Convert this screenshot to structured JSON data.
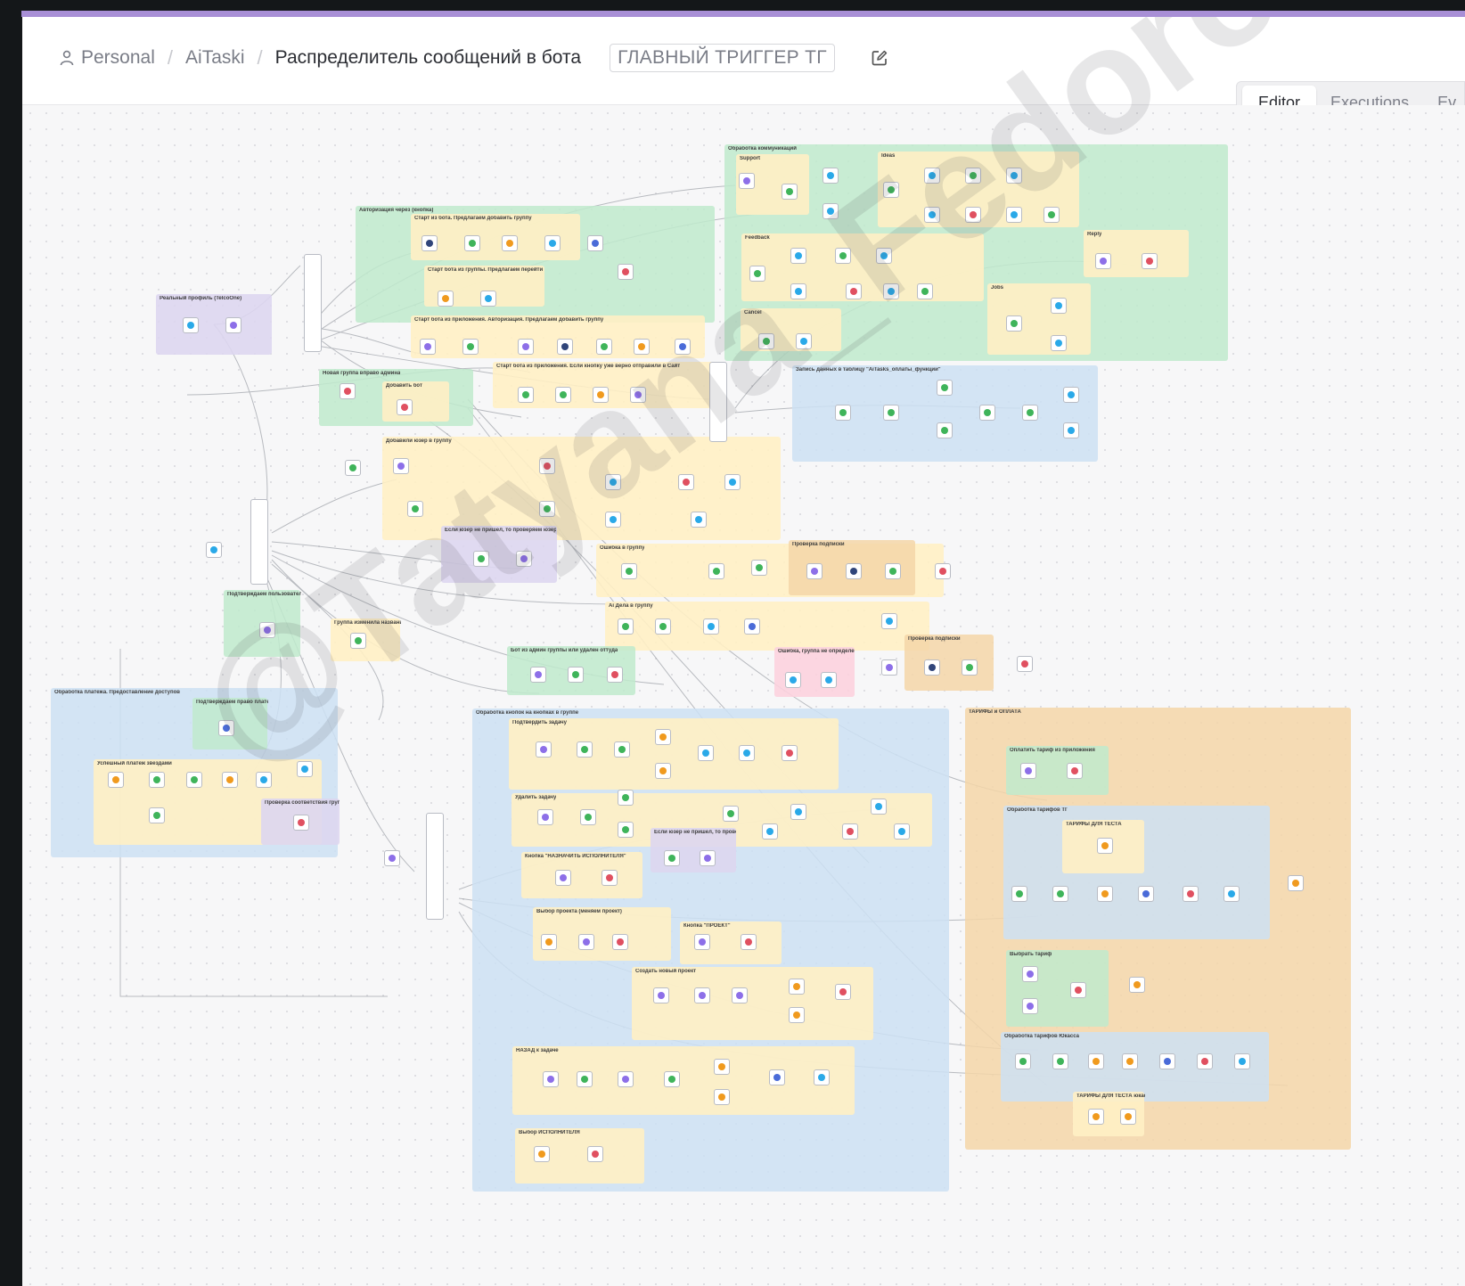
{
  "header": {
    "breadcrumb": {
      "owner": "Personal",
      "project": "AiTaski",
      "workflow": "Распределитель сообщений в бота"
    },
    "tag": "ГЛАВНЫЙ ТРИГГЕР ТГ",
    "tabs": [
      {
        "label": "Editor",
        "active": true
      },
      {
        "label": "Executions"
      },
      {
        "label": "Ev"
      }
    ]
  },
  "canvas": {
    "sticky_notes": [
      "Обработка коммуникаций",
      "Авторизация через (кнопка)",
      "Старт из бота. Предлагаем добавить группу",
      "Старт бота из группы. Предлагаем перейти в настройки приложения",
      "Старт бота из приложения. Авторизация. Предлагаем добавить группу",
      "Старт бота из приложения. Если кнопку уже верно отправили в Сайт",
      "Реальный профиль (TelcoOne)",
      "Новая группа вправо админа",
      "Добавить бот",
      "Добавили юзер в группу",
      "Если юзер не пришел, то проверяем юзер группы",
      "Ошибка в группу",
      "Проверка подписки",
      "Ai Дела в группу",
      "Бот из админ группы или удален оттуда",
      "Ошибка, группа не определена",
      "Проверка подписки",
      "Подтверждаем пользователя в приложении",
      "Группа изменила название",
      "Обработка платежа. Предоставление доступов",
      "Подтверждаем право платежа Телеграм, звезды",
      "Успешный платеж звездами",
      "Проверка соответствия группы и текущего тарифа",
      "Обработка кнопок на кнопках в группе",
      "Подтвердить задачу",
      "Удалить задачу",
      "Если юзер не пришел, то проверяем юзер группы",
      "Кнопка \"НАЗНАЧИТЬ ИСПОЛНИТЕЛЯ\"",
      "Выбор проекта (меняем проект)",
      "Кнопка \"ПРОЕКТ\"",
      "Создать новый проект",
      "НАЗАД к задаче",
      "Выбор ИСПОЛНИТЕЛЯ",
      "ТАРИФЫ и ОПЛАТА",
      "Оплатить тариф из приложения",
      "Обработка тарифов ТГ",
      "ТАРИФЫ ДЛЯ ТЕСТА",
      "Выбрать тариф",
      "Обработка тарифов Юкасса",
      "ТАРИФЫ ДЛЯ ТЕСТА юкасса",
      "Запись данных в таблицу \"AiTasks_оплаты_функции\"",
      "Support",
      "Ideas",
      "Feedback",
      "Cancel",
      "Jobs",
      "Reply"
    ]
  },
  "watermark": "@Tatyana_Fedorova",
  "colors": {
    "accent_bar": "#a88fd6",
    "active_tab": "#ffffff",
    "canvas": "#f7f7f8"
  }
}
